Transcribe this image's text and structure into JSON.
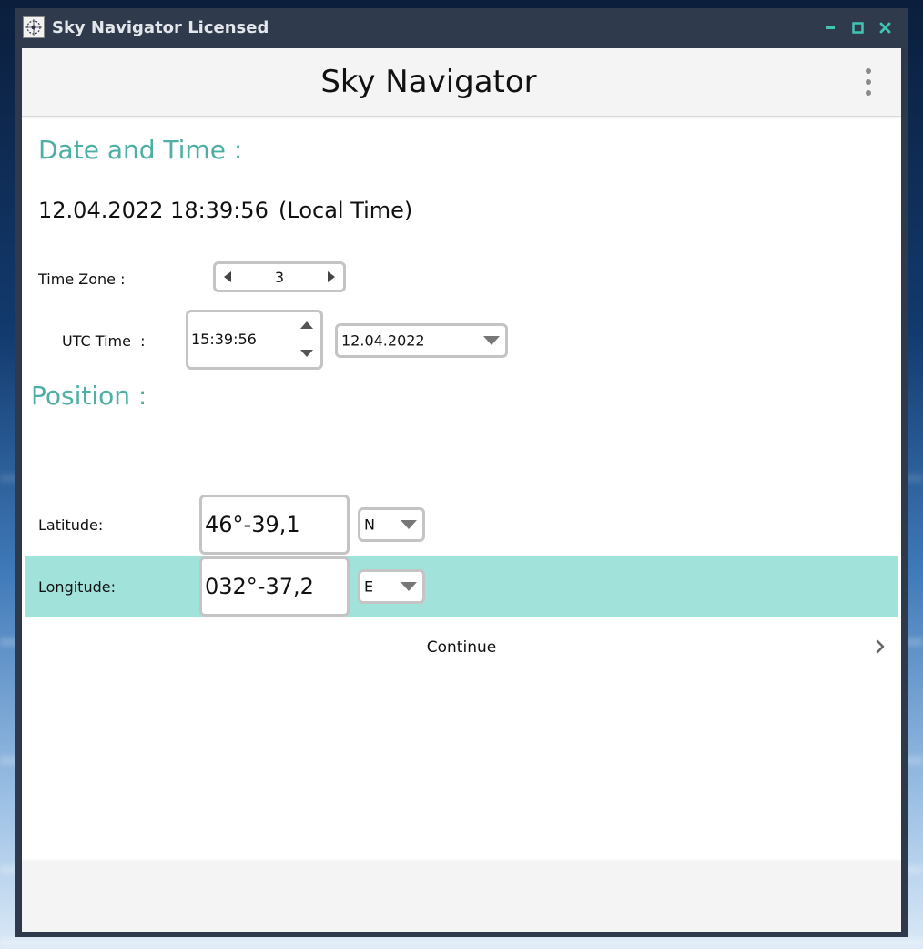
{
  "window": {
    "title": "Sky Navigator Licensed",
    "accent_color": "#40c4b4",
    "titlebar_color": "#2f3b4c",
    "controls": {
      "minimize_icon": "minimize-icon",
      "maximize_icon": "maximize-icon",
      "close_icon": "close-icon"
    }
  },
  "header": {
    "title": "Sky Navigator",
    "menu_icon": "kebab-menu-icon"
  },
  "date_time": {
    "heading": "Date and Time :",
    "local_datetime": "12.04.2022 18:39:56",
    "local_suffix": "(Local Time)",
    "time_zone_label": "Time Zone :",
    "time_zone_value": "3",
    "utc_label": "UTC Time  :",
    "utc_time_value": "15:39:56",
    "utc_date_value": "12.04.2022"
  },
  "position": {
    "heading": "Position :",
    "latitude_label": "Latitude:",
    "latitude_value": "46°-39,1",
    "latitude_hemisphere": "N",
    "longitude_label": "Longitude:",
    "longitude_value": "032°-37,2",
    "longitude_hemisphere": "E",
    "highlight_color": "#a1e3db"
  },
  "actions": {
    "continue_label": "Continue"
  },
  "colors": {
    "heading": "#4eafa4",
    "input_border": "#c4c4c4"
  }
}
